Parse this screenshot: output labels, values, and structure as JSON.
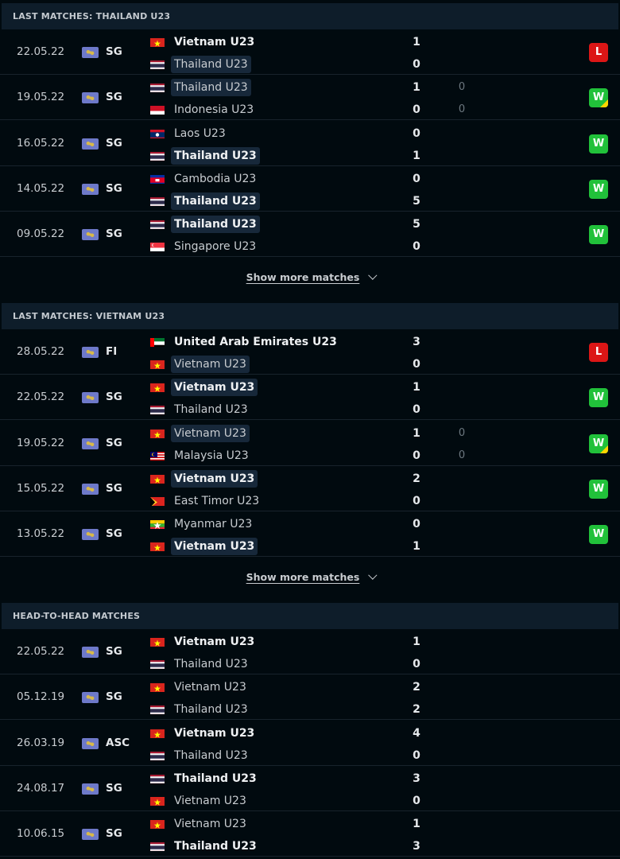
{
  "sections": [
    {
      "title": "LAST MATCHES: THAILAND U23",
      "show_more": "Show more matches",
      "matches": [
        {
          "date": "22.05.22",
          "comp": "SG",
          "home": {
            "name": "Vietnam U23",
            "flag": "vn",
            "win": true,
            "hl": false
          },
          "away": {
            "name": "Thailand U23",
            "flag": "th",
            "win": false,
            "hl": true
          },
          "hs": "1",
          "as": "0",
          "hp": "",
          "ap": "",
          "result": "L",
          "pen": false
        },
        {
          "date": "19.05.22",
          "comp": "SG",
          "home": {
            "name": "Thailand U23",
            "flag": "th",
            "win": false,
            "hl": true
          },
          "away": {
            "name": "Indonesia U23",
            "flag": "id",
            "win": false,
            "hl": false
          },
          "hs": "1",
          "as": "0",
          "hp": "0",
          "ap": "0",
          "result": "W",
          "pen": true
        },
        {
          "date": "16.05.22",
          "comp": "SG",
          "home": {
            "name": "Laos U23",
            "flag": "la",
            "win": false,
            "hl": false
          },
          "away": {
            "name": "Thailand U23",
            "flag": "th",
            "win": true,
            "hl": true
          },
          "hs": "0",
          "as": "1",
          "hp": "",
          "ap": "",
          "result": "W",
          "pen": false
        },
        {
          "date": "14.05.22",
          "comp": "SG",
          "home": {
            "name": "Cambodia U23",
            "flag": "kh",
            "win": false,
            "hl": false
          },
          "away": {
            "name": "Thailand U23",
            "flag": "th",
            "win": true,
            "hl": true
          },
          "hs": "0",
          "as": "5",
          "hp": "",
          "ap": "",
          "result": "W",
          "pen": false
        },
        {
          "date": "09.05.22",
          "comp": "SG",
          "home": {
            "name": "Thailand U23",
            "flag": "th",
            "win": true,
            "hl": true
          },
          "away": {
            "name": "Singapore U23",
            "flag": "sg",
            "win": false,
            "hl": false
          },
          "hs": "5",
          "as": "0",
          "hp": "",
          "ap": "",
          "result": "W",
          "pen": false
        }
      ]
    },
    {
      "title": "LAST MATCHES: VIETNAM U23",
      "show_more": "Show more matches",
      "matches": [
        {
          "date": "28.05.22",
          "comp": "FI",
          "home": {
            "name": "United Arab Emirates U23",
            "flag": "ae",
            "win": true,
            "hl": false
          },
          "away": {
            "name": "Vietnam U23",
            "flag": "vn",
            "win": false,
            "hl": true
          },
          "hs": "3",
          "as": "0",
          "hp": "",
          "ap": "",
          "result": "L",
          "pen": false
        },
        {
          "date": "22.05.22",
          "comp": "SG",
          "home": {
            "name": "Vietnam U23",
            "flag": "vn",
            "win": true,
            "hl": true
          },
          "away": {
            "name": "Thailand U23",
            "flag": "th",
            "win": false,
            "hl": false
          },
          "hs": "1",
          "as": "0",
          "hp": "",
          "ap": "",
          "result": "W",
          "pen": false
        },
        {
          "date": "19.05.22",
          "comp": "SG",
          "home": {
            "name": "Vietnam U23",
            "flag": "vn",
            "win": false,
            "hl": true
          },
          "away": {
            "name": "Malaysia U23",
            "flag": "my",
            "win": false,
            "hl": false
          },
          "hs": "1",
          "as": "0",
          "hp": "0",
          "ap": "0",
          "result": "W",
          "pen": true
        },
        {
          "date": "15.05.22",
          "comp": "SG",
          "home": {
            "name": "Vietnam U23",
            "flag": "vn",
            "win": true,
            "hl": true
          },
          "away": {
            "name": "East Timor U23",
            "flag": "tl",
            "win": false,
            "hl": false
          },
          "hs": "2",
          "as": "0",
          "hp": "",
          "ap": "",
          "result": "W",
          "pen": false
        },
        {
          "date": "13.05.22",
          "comp": "SG",
          "home": {
            "name": "Myanmar U23",
            "flag": "mm",
            "win": false,
            "hl": false
          },
          "away": {
            "name": "Vietnam U23",
            "flag": "vn",
            "win": true,
            "hl": true
          },
          "hs": "0",
          "as": "1",
          "hp": "",
          "ap": "",
          "result": "W",
          "pen": false
        }
      ]
    },
    {
      "title": "HEAD-TO-HEAD MATCHES",
      "show_more": "",
      "matches": [
        {
          "date": "22.05.22",
          "comp": "SG",
          "home": {
            "name": "Vietnam U23",
            "flag": "vn",
            "win": true,
            "hl": false
          },
          "away": {
            "name": "Thailand U23",
            "flag": "th",
            "win": false,
            "hl": false
          },
          "hs": "1",
          "as": "0",
          "hp": "",
          "ap": "",
          "result": "",
          "pen": false
        },
        {
          "date": "05.12.19",
          "comp": "SG",
          "home": {
            "name": "Vietnam U23",
            "flag": "vn",
            "win": false,
            "hl": false
          },
          "away": {
            "name": "Thailand U23",
            "flag": "th",
            "win": false,
            "hl": false
          },
          "hs": "2",
          "as": "2",
          "hp": "",
          "ap": "",
          "result": "",
          "pen": false
        },
        {
          "date": "26.03.19",
          "comp": "ASC",
          "home": {
            "name": "Vietnam U23",
            "flag": "vn",
            "win": true,
            "hl": false
          },
          "away": {
            "name": "Thailand U23",
            "flag": "th",
            "win": false,
            "hl": false
          },
          "hs": "4",
          "as": "0",
          "hp": "",
          "ap": "",
          "result": "",
          "pen": false
        },
        {
          "date": "24.08.17",
          "comp": "SG",
          "home": {
            "name": "Thailand U23",
            "flag": "th",
            "win": true,
            "hl": false
          },
          "away": {
            "name": "Vietnam U23",
            "flag": "vn",
            "win": false,
            "hl": false
          },
          "hs": "3",
          "as": "0",
          "hp": "",
          "ap": "",
          "result": "",
          "pen": false
        },
        {
          "date": "10.06.15",
          "comp": "SG",
          "home": {
            "name": "Vietnam U23",
            "flag": "vn",
            "win": false,
            "hl": false
          },
          "away": {
            "name": "Thailand U23",
            "flag": "th",
            "win": true,
            "hl": false
          },
          "hs": "1",
          "as": "3",
          "hp": "",
          "ap": "",
          "result": "",
          "pen": false
        }
      ]
    }
  ],
  "colors": {
    "win": "#21c13a",
    "loss": "#dc1616",
    "header_bg": "#0e1d2a",
    "page_bg": "#010a0f"
  }
}
